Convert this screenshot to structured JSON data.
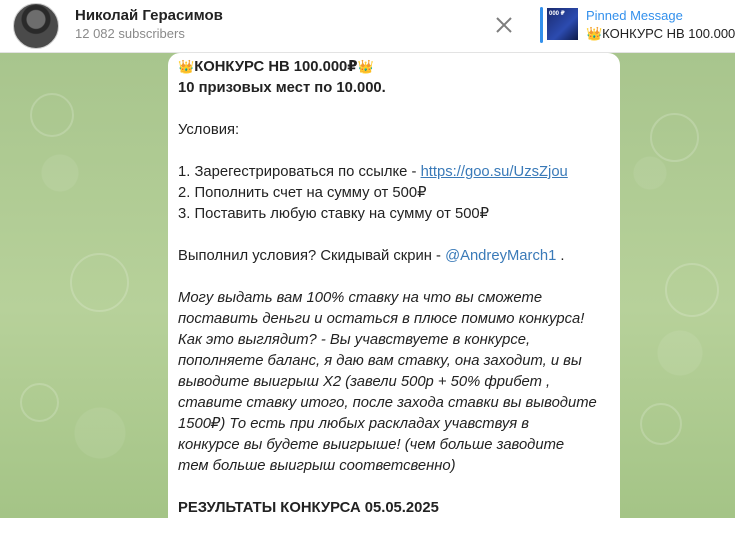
{
  "channel": {
    "name": "Николай Герасимов",
    "subscribers": "12 082 subscribers"
  },
  "pinned": {
    "label": "Pinned Message",
    "text": "👑КОНКУРС НВ 100.000",
    "thumb_text": "000 ₽"
  },
  "message": {
    "title": "КОНКУРС НВ 100.000₽",
    "crown": "👑",
    "line2": "10 призовых мест по 10.000.",
    "conditions_label": "Условия:",
    "step1_prefix": "1. Зарегестрироваться по ссылке - ",
    "step1_link": "https://goo.su/UzsZjou",
    "step2": "2. Пополнить счет на сумму от 500₽",
    "step3": "3. Поставить любую ставку на сумму от 500₽",
    "done_prefix": "Выполнил условия? Скидывай скрин - ",
    "done_mention": "@AndreyMarch1",
    "done_suffix": " .",
    "italic_lines": [
      "Могу выдать вам 100% ставку на что вы сможете",
      "поставить деньги и остаться в плюсе помимо конкурса!",
      "Как это выглядит? - Вы учавствуете в конкурсе,",
      "пополняете баланс, я даю вам ставку, она заходит, и вы",
      "выводите выигрыш Х2 (завели 500р + 50% фрибет ,",
      " ставите ставку  итого, после захода ставки вы выводите",
      "1500₽) То есть при любых раскладах учавствуя в",
      "конкурсе вы будете выигрыше! (чем больше заводите",
      "тем больше выигрыш соответсвенно)"
    ],
    "results": "РЕЗУЛЬТАТЫ КОНКУРСА 05.05.2025"
  }
}
